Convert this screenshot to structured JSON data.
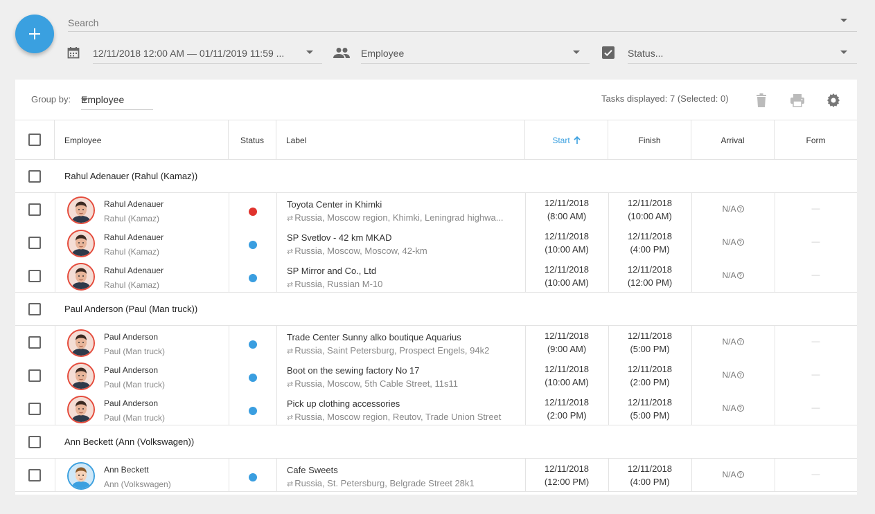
{
  "search": {
    "placeholder": "Search"
  },
  "filters": {
    "date_range": "12/11/2018 12:00 AM — 01/11/2019 11:59 ...",
    "employee": "Employee",
    "status": "Status..."
  },
  "toolbar": {
    "group_by_label": "Group by:",
    "group_by_value": "Employee",
    "tasks_displayed": "Tasks displayed: 7 (Selected: 0)"
  },
  "columns": {
    "employee": "Employee",
    "status": "Status",
    "label": "Label",
    "start": "Start",
    "finish": "Finish",
    "arrival": "Arrival",
    "form": "Form"
  },
  "colors": {
    "accent": "#3aa0e0",
    "status_red": "#e0332d",
    "status_blue": "#3a9ee0"
  },
  "groups": [
    {
      "title": "Rahul Adenauer (Rahul (Kamaz))",
      "rows": [
        {
          "name": "Rahul Adenauer",
          "sub": "Rahul (Kamaz)",
          "status": "red",
          "label": "Toyota Center in Khimki",
          "address": "Russia, Moscow region, Khimki, Leningrad highwa...",
          "start_date": "12/11/2018",
          "start_time": "(8:00 AM)",
          "finish_date": "12/11/2018",
          "finish_time": "(10:00 AM)",
          "arrival": "N/A",
          "form": "—"
        },
        {
          "name": "Rahul Adenauer",
          "sub": "Rahul (Kamaz)",
          "status": "blue",
          "label": "SP Svetlov - 42 km MKAD",
          "address": "Russia, Moscow, Moscow, 42-km",
          "start_date": "12/11/2018",
          "start_time": "(10:00 AM)",
          "finish_date": "12/11/2018",
          "finish_time": "(4:00 PM)",
          "arrival": "N/A",
          "form": "—"
        },
        {
          "name": "Rahul Adenauer",
          "sub": "Rahul (Kamaz)",
          "status": "blue",
          "label": "SP Mirror and Co., Ltd",
          "address": "Russia, Russian M-10",
          "start_date": "12/11/2018",
          "start_time": "(10:00 AM)",
          "finish_date": "12/11/2018",
          "finish_time": "(12:00 PM)",
          "arrival": "N/A",
          "form": "—"
        }
      ]
    },
    {
      "title": "Paul Anderson (Paul (Man truck))",
      "rows": [
        {
          "name": "Paul Anderson",
          "sub": "Paul (Man truck)",
          "status": "blue",
          "label": "Trade Center Sunny alko boutique Aquarius",
          "address": "Russia, Saint Petersburg, Prospect Engels, 94k2",
          "start_date": "12/11/2018",
          "start_time": "(9:00 AM)",
          "finish_date": "12/11/2018",
          "finish_time": "(5:00 PM)",
          "arrival": "N/A",
          "form": "—"
        },
        {
          "name": "Paul Anderson",
          "sub": "Paul (Man truck)",
          "status": "blue",
          "label": "Boot on the sewing factory No 17",
          "address": "Russia, Moscow, 5th Cable Street, 11s11",
          "start_date": "12/11/2018",
          "start_time": "(10:00 AM)",
          "finish_date": "12/11/2018",
          "finish_time": "(2:00 PM)",
          "arrival": "N/A",
          "form": "—"
        },
        {
          "name": "Paul Anderson",
          "sub": "Paul (Man truck)",
          "status": "blue",
          "label": "Pick up clothing accessories",
          "address": "Russia, Moscow region, Reutov, Trade Union Street",
          "start_date": "12/11/2018",
          "start_time": "(2:00 PM)",
          "finish_date": "12/11/2018",
          "finish_time": "(5:00 PM)",
          "arrival": "N/A",
          "form": "—"
        }
      ]
    },
    {
      "title": "Ann Beckett (Ann (Volkswagen))",
      "rows": [
        {
          "name": "Ann Beckett",
          "sub": "Ann (Volkswagen)",
          "status": "blue",
          "label": "Cafe Sweets",
          "address": "Russia, St. Petersburg, Belgrade Street 28k1",
          "start_date": "12/11/2018",
          "start_time": "(12:00 PM)",
          "finish_date": "12/11/2018",
          "finish_time": "(4:00 PM)",
          "arrival": "N/A",
          "form": "—"
        }
      ]
    }
  ]
}
